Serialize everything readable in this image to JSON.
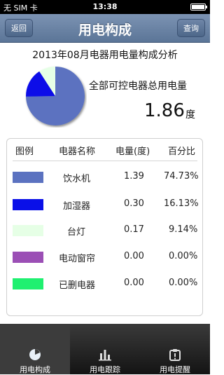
{
  "status_bar": {
    "carrier": "无 SIM 卡",
    "time": "13:38"
  },
  "nav": {
    "back_label": "返回",
    "title": "用电构成",
    "query_label": "查询"
  },
  "summary": {
    "title": "2013年08月电器用电量构成分析",
    "total_label": "全部可控电器总用电量",
    "total_value": "1.86",
    "total_unit": "度"
  },
  "chart_data": {
    "type": "pie",
    "categories": [
      "饮水机",
      "加湿器",
      "台灯",
      "电动窗帘",
      "已删电器"
    ],
    "values": [
      1.39,
      0.3,
      0.17,
      0.0,
      0.0
    ],
    "colors": [
      "#5b72c0",
      "#0a10e8",
      "#e6ffe6",
      "#9b4fb5",
      "#1ff070"
    ]
  },
  "table": {
    "headers": [
      "图例",
      "电器名称",
      "电量(度)",
      "百分比"
    ],
    "rows": [
      {
        "name": "饮水机",
        "usage": "1.39",
        "percent": "74.73%",
        "color": "#5b72c0"
      },
      {
        "name": "加湿器",
        "usage": "0.30",
        "percent": "16.13%",
        "color": "#0a10e8"
      },
      {
        "name": "台灯",
        "usage": "0.17",
        "percent": "9.14%",
        "color": "#e6ffe6"
      },
      {
        "name": "电动窗帘",
        "usage": "0.00",
        "percent": "0.00%",
        "color": "#9b4fb5"
      },
      {
        "name": "已删电器",
        "usage": "0.00",
        "percent": "0.00%",
        "color": "#1ff070"
      }
    ]
  },
  "tabs": [
    {
      "label": "用电构成",
      "icon": "pie-chart-icon",
      "active": true
    },
    {
      "label": "用电跟踪",
      "icon": "bar-chart-icon",
      "active": false
    },
    {
      "label": "用电提醒",
      "icon": "reminder-icon",
      "active": false
    }
  ]
}
